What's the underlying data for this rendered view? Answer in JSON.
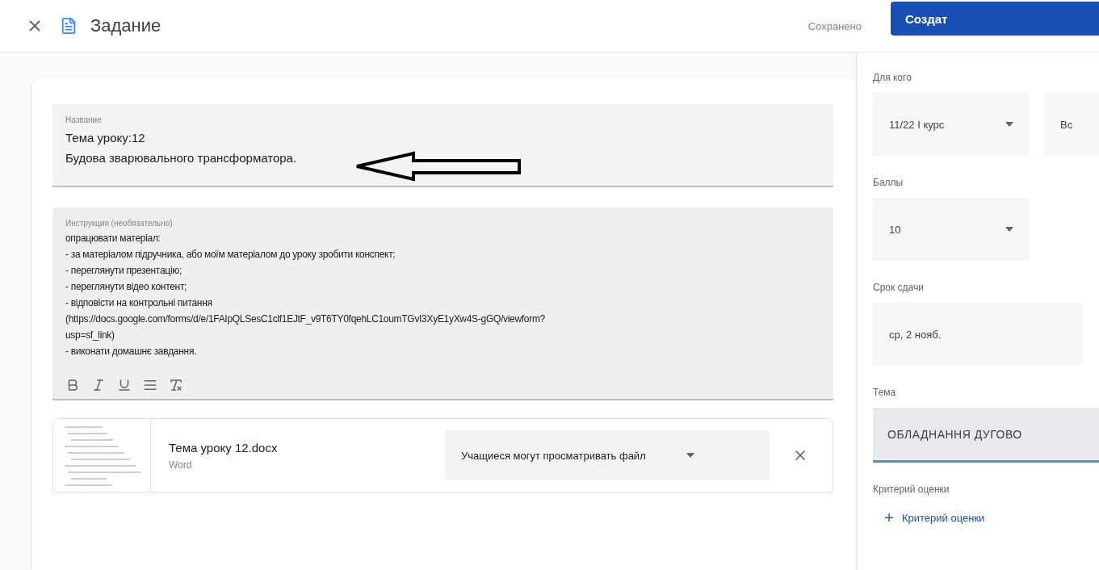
{
  "header": {
    "title": "Задание",
    "status": "Сохранено",
    "primary_button": "Создат"
  },
  "title_field": {
    "label": "Название",
    "lines": [
      "Тема уроку:12",
      "Будова зварювального трансформатора."
    ]
  },
  "instructions_field": {
    "label": "Инструкция (необязательно)",
    "lines": [
      "опрацювати матеріал:",
      "- за матеріалом підручника, або моїм матеріалом до  уроку зробити конспект;",
      "- переглянути презентацію;",
      "- переглянути відео контент;",
      "- відповісти на контрольні питання",
      "(https://docs.google.com/forms/d/e/1FAIpQLSesC1clf1EJtF_v9T6TY0fqehLC1oumTGvI3XyE1yXw4S-gGQ/viewform?",
      "usp=sf_link)",
      "- виконати домашнє завдання."
    ]
  },
  "attachment": {
    "name": "Тема уроку 12.docx",
    "type": "Word",
    "permission": "Учащиеся могут просматривать файл"
  },
  "sidebar": {
    "sections": [
      {
        "kind": "selects",
        "label": "Для кого",
        "values": [
          "11/22 І курс",
          "Вс"
        ]
      },
      {
        "kind": "select",
        "label": "Баллы",
        "values": [
          "10"
        ]
      },
      {
        "kind": "field",
        "label": "Срок сдачи",
        "values": [
          "ср, 2 нояб."
        ]
      },
      {
        "kind": "topic",
        "label": "Тема",
        "values": [
          "ОБЛАДНАННЯ ДУГОВО"
        ]
      },
      {
        "kind": "add",
        "label": "Критерий оценки",
        "values": [
          "Критерий оценки"
        ]
      }
    ]
  }
}
